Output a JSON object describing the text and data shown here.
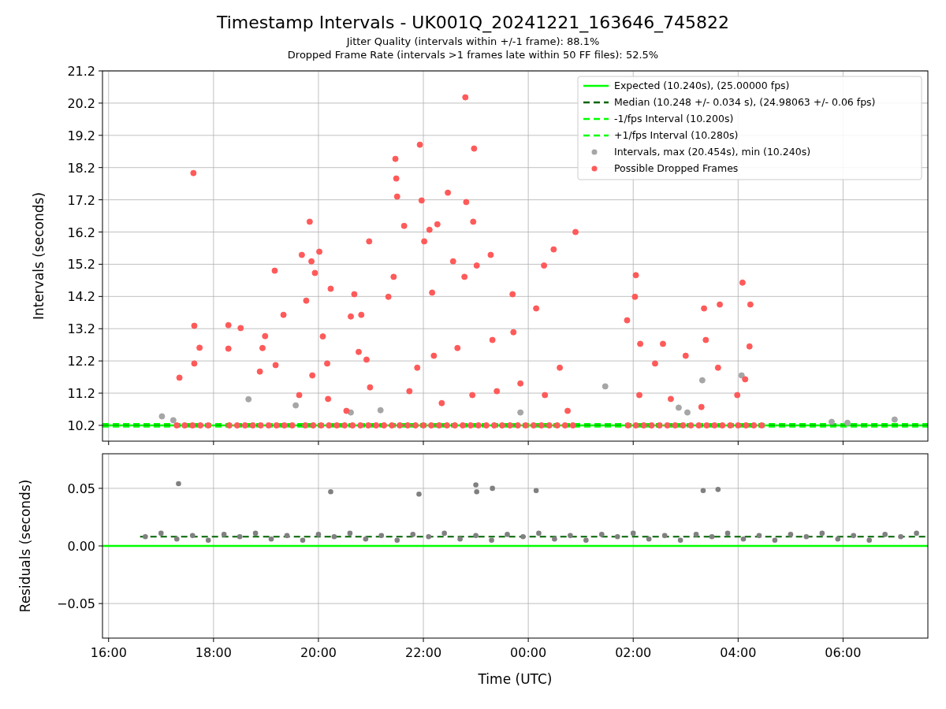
{
  "title": "Timestamp Intervals - UK001Q_20241221_163646_745822",
  "subtitles": [
    "Jitter Quality (intervals within +/-1 frame): 88.1%",
    "Dropped Frame Rate (intervals >1 frames late within 50 FF files): 52.5%"
  ],
  "intervals_plot": {
    "chart_data": {
      "type": "scatter",
      "ylabel": "Intervals (seconds)",
      "xlim": [
        "2024-12-21 15:53",
        "2024-12-22 07:37"
      ],
      "ylim": [
        9.75,
        21.24
      ],
      "yticks": [
        {
          "value": 10.24,
          "label": "10.2"
        },
        {
          "value": 11.24,
          "label": "11.2"
        },
        {
          "value": 12.24,
          "label": "12.2"
        },
        {
          "value": 13.24,
          "label": "13.2"
        },
        {
          "value": 14.24,
          "label": "14.2"
        },
        {
          "value": 15.24,
          "label": "15.2"
        },
        {
          "value": 16.24,
          "label": "16.2"
        },
        {
          "value": 17.24,
          "label": "17.2"
        },
        {
          "value": 18.24,
          "label": "18.2"
        },
        {
          "value": 19.24,
          "label": "19.2"
        },
        {
          "value": 20.24,
          "label": "20.2"
        },
        {
          "value": 21.24,
          "label": "21.2"
        }
      ],
      "grid": true,
      "legend": true,
      "series": [
        {
          "name": "Expected (10.240s), (25.00000 fps)",
          "type": "line",
          "line_style": "solid",
          "color": "#00ff00",
          "x": [
            "2024-12-21 15:53",
            "2024-12-22 07:37"
          ],
          "values": [
            10.24,
            10.24
          ]
        },
        {
          "name": "Median (10.248 +/- 0.034 s), (24.98063 +/- 0.06 fps)",
          "type": "line",
          "line_style": "dashed",
          "color": "#006400",
          "x": [
            "2024-12-21 15:53",
            "2024-12-22 07:37"
          ],
          "values": [
            10.248,
            10.248
          ]
        },
        {
          "name": "-1/fps Interval (10.200s)",
          "type": "line",
          "line_style": "dashed",
          "color": "#00ff00",
          "x": [
            "2024-12-21 15:53",
            "2024-12-22 07:37"
          ],
          "values": [
            10.2,
            10.2
          ]
        },
        {
          "name": "+1/fps Interval (10.280s)",
          "type": "line",
          "line_style": "dashed",
          "color": "#00ff00",
          "x": [
            "2024-12-21 15:53",
            "2024-12-22 07:37"
          ],
          "values": [
            10.28,
            10.28
          ]
        },
        {
          "name": "Intervals, max (20.454s), min (10.240s)",
          "type": "scatter",
          "color": "#a6a6a6",
          "x": [
            "2024-12-21 17:01",
            "2024-12-21 17:14",
            "2024-12-21 19:34",
            "2024-12-21 20:37",
            "2024-12-21 21:11",
            "2024-12-22 01:28",
            "2024-12-22 02:52",
            "2024-12-22 03:02",
            "2024-12-22 03:19",
            "2024-12-22 04:04",
            "2024-12-22 05:47",
            "2024-12-22 06:05",
            "2024-12-22 06:59",
            "2024-12-21 18:40",
            "2024-12-21 23:51"
          ],
          "values": [
            10.52,
            10.4,
            10.86,
            10.64,
            10.71,
            11.45,
            10.79,
            10.64,
            11.64,
            11.79,
            10.35,
            10.32,
            10.42,
            11.05,
            10.64
          ]
        },
        {
          "name": "Possible Dropped Frames",
          "type": "scatter",
          "color": "#ff5a5a",
          "x": [
            "2024-12-21 17:18",
            "2024-12-21 17:27",
            "2024-12-21 17:36",
            "2024-12-21 17:45",
            "2024-12-21 17:54",
            "2024-12-21 18:18",
            "2024-12-21 18:27",
            "2024-12-21 18:36",
            "2024-12-21 18:45",
            "2024-12-21 18:54",
            "2024-12-21 19:03",
            "2024-12-21 19:12",
            "2024-12-21 19:21",
            "2024-12-21 19:30",
            "2024-12-21 19:45",
            "2024-12-21 19:54",
            "2024-12-21 20:03",
            "2024-12-21 20:12",
            "2024-12-21 20:21",
            "2024-12-21 20:30",
            "2024-12-21 20:39",
            "2024-12-21 20:48",
            "2024-12-21 20:57",
            "2024-12-21 21:06",
            "2024-12-21 21:15",
            "2024-12-21 21:24",
            "2024-12-21 21:33",
            "2024-12-21 21:42",
            "2024-12-21 21:51",
            "2024-12-21 22:00",
            "2024-12-21 22:09",
            "2024-12-21 22:18",
            "2024-12-21 22:27",
            "2024-12-21 22:36",
            "2024-12-21 22:45",
            "2024-12-21 22:54",
            "2024-12-21 23:03",
            "2024-12-21 23:12",
            "2024-12-21 23:21",
            "2024-12-21 23:30",
            "2024-12-21 23:39",
            "2024-12-21 23:48",
            "2024-12-21 23:57",
            "2024-12-22 00:06",
            "2024-12-22 00:15",
            "2024-12-22 00:24",
            "2024-12-22 00:33",
            "2024-12-22 00:42",
            "2024-12-22 00:51",
            "2024-12-22 01:54",
            "2024-12-22 02:03",
            "2024-12-22 02:12",
            "2024-12-22 02:21",
            "2024-12-22 02:30",
            "2024-12-22 02:39",
            "2024-12-22 02:48",
            "2024-12-22 02:57",
            "2024-12-22 03:06",
            "2024-12-22 03:15",
            "2024-12-22 03:24",
            "2024-12-22 03:33",
            "2024-12-22 03:42",
            "2024-12-22 03:51",
            "2024-12-22 04:00",
            "2024-12-22 04:09",
            "2024-12-22 04:18",
            "2024-12-22 04:27",
            "2024-12-21 17:37",
            "2024-12-21 17:21",
            "2024-12-21 17:38",
            "2024-12-21 17:38",
            "2024-12-21 17:44",
            "2024-12-21 18:17",
            "2024-12-21 18:17",
            "2024-12-21 18:31",
            "2024-12-21 18:53",
            "2024-12-21 18:56",
            "2024-12-21 18:59",
            "2024-12-21 19:10",
            "2024-12-21 19:11",
            "2024-12-21 19:20",
            "2024-12-21 19:41",
            "2024-12-21 19:46",
            "2024-12-21 19:50",
            "2024-12-21 19:52",
            "2024-12-21 19:56",
            "2024-12-21 20:01",
            "2024-12-21 20:05",
            "2024-12-21 20:10",
            "2024-12-21 20:14",
            "2024-12-21 20:37",
            "2024-12-21 20:41",
            "2024-12-21 20:46",
            "2024-12-21 20:49",
            "2024-12-21 20:58",
            "2024-12-21 21:20",
            "2024-12-21 21:26",
            "2024-12-21 21:28",
            "2024-12-21 21:29",
            "2024-12-21 21:30",
            "2024-12-21 21:38",
            "2024-12-21 21:56",
            "2024-12-21 21:58",
            "2024-12-21 22:07",
            "2024-12-21 22:01",
            "2024-12-21 22:10",
            "2024-12-21 22:16",
            "2024-12-21 22:28",
            "2024-12-21 22:34",
            "2024-12-21 22:48",
            "2024-12-21 22:49",
            "2024-12-21 22:57",
            "2024-12-21 22:58",
            "2024-12-21 22:47",
            "2024-12-21 23:01",
            "2024-12-21 23:17",
            "2024-12-21 23:42",
            "2024-12-22 00:09",
            "2024-12-22 00:18",
            "2024-12-22 00:29",
            "2024-12-22 00:54",
            "2024-12-21 23:43",
            "2024-12-22 00:36",
            "2024-12-22 01:53",
            "2024-12-22 02:02",
            "2024-12-22 02:03",
            "2024-12-22 02:08",
            "2024-12-22 02:25",
            "2024-12-22 02:34",
            "2024-12-22 03:00",
            "2024-12-22 03:21",
            "2024-12-22 03:23",
            "2024-12-22 03:39",
            "2024-12-22 03:37",
            "2024-12-22 04:05",
            "2024-12-22 04:14",
            "2024-12-22 04:13",
            "2024-12-22 04:08",
            "2024-12-22 03:59",
            "2024-12-21 19:38",
            "2024-12-21 20:11",
            "2024-12-21 20:32",
            "2024-12-21 20:59",
            "2024-12-21 21:44",
            "2024-12-21 22:21",
            "2024-12-21 22:56",
            "2024-12-21 23:24",
            "2024-12-21 23:51",
            "2024-12-22 00:19",
            "2024-12-22 00:45",
            "2024-12-22 02:07",
            "2024-12-22 02:43",
            "2024-12-22 03:18",
            "2024-12-21 19:53",
            "2024-12-21 20:55",
            "2024-12-21 21:53",
            "2024-12-21 22:39",
            "2024-12-21 23:19",
            "2024-12-21 22:12"
          ],
          "values": [
            10.24,
            10.24,
            10.24,
            10.24,
            10.24,
            10.24,
            10.24,
            10.24,
            10.24,
            10.24,
            10.24,
            10.24,
            10.24,
            10.24,
            10.24,
            10.24,
            10.24,
            10.24,
            10.24,
            10.24,
            10.24,
            10.24,
            10.24,
            10.24,
            10.24,
            10.24,
            10.24,
            10.24,
            10.24,
            10.24,
            10.24,
            10.24,
            10.24,
            10.24,
            10.24,
            10.24,
            10.24,
            10.24,
            10.24,
            10.24,
            10.24,
            10.24,
            10.24,
            10.24,
            10.24,
            10.24,
            10.24,
            10.24,
            10.24,
            10.24,
            10.24,
            10.24,
            10.24,
            10.24,
            10.24,
            10.24,
            10.24,
            10.24,
            10.24,
            10.24,
            10.24,
            10.24,
            10.24,
            10.24,
            10.24,
            10.24,
            10.24,
            18.07,
            11.72,
            13.33,
            12.16,
            12.65,
            13.35,
            12.62,
            13.26,
            11.91,
            12.64,
            13.01,
            15.04,
            12.11,
            13.67,
            15.53,
            14.11,
            16.56,
            15.33,
            14.97,
            15.63,
            13.0,
            12.16,
            14.48,
            13.62,
            14.31,
            12.52,
            13.67,
            15.95,
            14.23,
            14.85,
            18.51,
            17.9,
            17.34,
            16.43,
            18.95,
            17.22,
            16.31,
            15.95,
            14.36,
            16.48,
            17.46,
            15.33,
            20.42,
            17.17,
            16.56,
            18.83,
            14.85,
            15.2,
            15.53,
            14.31,
            13.87,
            15.2,
            15.7,
            16.24,
            13.13,
            12.03,
            13.5,
            14.23,
            14.9,
            12.77,
            12.16,
            12.77,
            12.4,
            13.87,
            12.89,
            13.99,
            12.03,
            14.67,
            13.99,
            12.69,
            11.67,
            11.18,
            11.18,
            11.06,
            10.69,
            11.42,
            11.3,
            10.93,
            11.18,
            11.3,
            11.54,
            11.18,
            10.69,
            11.18,
            11.06,
            10.81,
            11.79,
            12.28,
            12.03,
            12.64,
            12.89,
            12.4
          ]
        }
      ]
    }
  },
  "residuals_plot": {
    "chart_data": {
      "type": "scatter",
      "xlabel": "Time (UTC)",
      "ylabel": "Residuals (seconds)",
      "xlim": [
        "2024-12-21 15:53",
        "2024-12-22 07:37"
      ],
      "ylim": [
        -0.08,
        0.08
      ],
      "xticks": [
        {
          "value": "2024-12-21 16:00",
          "label": "16:00"
        },
        {
          "value": "2024-12-21 18:00",
          "label": "18:00"
        },
        {
          "value": "2024-12-21 20:00",
          "label": "20:00"
        },
        {
          "value": "2024-12-21 22:00",
          "label": "22:00"
        },
        {
          "value": "2024-12-22 00:00",
          "label": "00:00"
        },
        {
          "value": "2024-12-22 02:00",
          "label": "02:00"
        },
        {
          "value": "2024-12-22 04:00",
          "label": "04:00"
        },
        {
          "value": "2024-12-22 06:00",
          "label": "06:00"
        }
      ],
      "yticks": [
        {
          "value": 0.05,
          "label": "0.05"
        },
        {
          "value": 0,
          "label": "0.00"
        },
        {
          "value": -0.05,
          "label": "−0.05"
        }
      ],
      "grid": true,
      "series": [
        {
          "type": "line",
          "line_style": "solid",
          "color": "#00ff00",
          "x": [
            "2024-12-21 15:53",
            "2024-12-22 07:37"
          ],
          "values": [
            0,
            0
          ]
        },
        {
          "type": "line",
          "line_style": "dashed",
          "color": "#006400",
          "x": [
            "2024-12-21 16:36",
            "2024-12-22 07:37"
          ],
          "values": [
            0.008,
            0.008
          ]
        },
        {
          "type": "scatter",
          "color": "#808080",
          "x": [
            "2024-12-21 16:42",
            "2024-12-21 17:00",
            "2024-12-21 17:18",
            "2024-12-21 17:36",
            "2024-12-21 17:54",
            "2024-12-21 18:12",
            "2024-12-21 18:30",
            "2024-12-21 18:48",
            "2024-12-21 19:06",
            "2024-12-21 19:24",
            "2024-12-21 19:42",
            "2024-12-21 20:00",
            "2024-12-21 20:18",
            "2024-12-21 20:36",
            "2024-12-21 20:54",
            "2024-12-21 21:12",
            "2024-12-21 21:30",
            "2024-12-21 21:48",
            "2024-12-21 22:06",
            "2024-12-21 22:24",
            "2024-12-21 22:42",
            "2024-12-21 23:00",
            "2024-12-21 23:18",
            "2024-12-21 23:36",
            "2024-12-21 23:54",
            "2024-12-22 00:12",
            "2024-12-22 00:30",
            "2024-12-22 00:48",
            "2024-12-22 01:06",
            "2024-12-22 01:24",
            "2024-12-22 01:42",
            "2024-12-22 02:00",
            "2024-12-22 02:18",
            "2024-12-22 02:36",
            "2024-12-22 02:54",
            "2024-12-22 03:12",
            "2024-12-22 03:30",
            "2024-12-22 03:48",
            "2024-12-22 04:06",
            "2024-12-22 04:24",
            "2024-12-22 04:42",
            "2024-12-22 05:00",
            "2024-12-22 05:18",
            "2024-12-22 05:36",
            "2024-12-22 05:54",
            "2024-12-22 06:12",
            "2024-12-22 06:30",
            "2024-12-22 06:48",
            "2024-12-22 07:06",
            "2024-12-22 07:24",
            "2024-12-21 17:20",
            "2024-12-21 20:14",
            "2024-12-21 21:55",
            "2024-12-21 23:00",
            "2024-12-21 23:01",
            "2024-12-21 23:19",
            "2024-12-22 00:09",
            "2024-12-22 03:20",
            "2024-12-22 03:37"
          ],
          "values": [
            0.008,
            0.011,
            0.006,
            0.009,
            0.005,
            0.01,
            0.008,
            0.011,
            0.006,
            0.009,
            0.005,
            0.01,
            0.008,
            0.011,
            0.006,
            0.009,
            0.005,
            0.01,
            0.008,
            0.011,
            0.006,
            0.009,
            0.005,
            0.01,
            0.008,
            0.011,
            0.006,
            0.009,
            0.005,
            0.01,
            0.008,
            0.011,
            0.006,
            0.009,
            0.005,
            0.01,
            0.008,
            0.011,
            0.006,
            0.009,
            0.005,
            0.01,
            0.008,
            0.011,
            0.006,
            0.009,
            0.005,
            0.01,
            0.008,
            0.011,
            0.054,
            0.047,
            0.045,
            0.053,
            0.047,
            0.05,
            0.048,
            0.048,
            0.049
          ]
        }
      ]
    }
  }
}
